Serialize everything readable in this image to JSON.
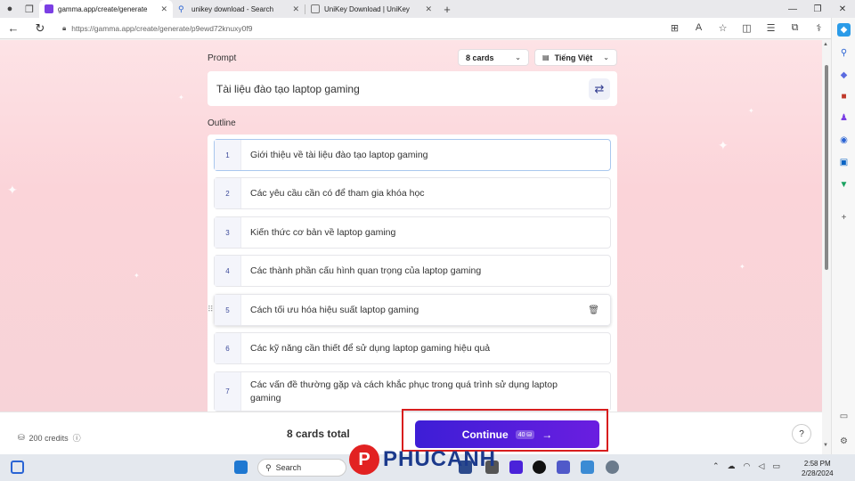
{
  "browser": {
    "tabs": [
      {
        "label": "gamma.app/create/generate",
        "active": true
      },
      {
        "label": "unikey download - Search",
        "active": false
      },
      {
        "label": "UniKey Download | UniKey",
        "active": false
      }
    ],
    "new_tab": "+",
    "url": "https://gamma.app/create/generate/p9ewd72knuxy0f9"
  },
  "prompt": {
    "label": "Prompt",
    "cards_select": "8 cards",
    "language_select": "Tiếng Việt",
    "value": "Tài liệu đào tạo laptop gaming"
  },
  "outline": {
    "label": "Outline",
    "items": [
      {
        "num": "1",
        "text": "Giới thiệu về tài liệu đào tạo laptop gaming"
      },
      {
        "num": "2",
        "text": "Các yêu cầu cần có để tham gia khóa học"
      },
      {
        "num": "3",
        "text": "Kiến thức cơ bản về laptop gaming"
      },
      {
        "num": "4",
        "text": "Các thành phần cấu hình quan trọng của laptop gaming"
      },
      {
        "num": "5",
        "text": "Cách tối ưu hóa hiệu suất laptop gaming"
      },
      {
        "num": "6",
        "text": "Các kỹ năng cần thiết để sử dụng laptop gaming hiệu quả"
      },
      {
        "num": "7",
        "text": "Các vấn đề thường gặp và cách khắc phục trong quá trình sử dụng laptop gaming"
      }
    ]
  },
  "footer": {
    "credits": "200 credits",
    "cards_total": "8 cards total",
    "continue_label": "Continue",
    "continue_cost": "40",
    "help": "?"
  },
  "taskbar": {
    "search_placeholder": "Search",
    "watermark": "PHUCANH",
    "time": "2:58 PM",
    "date": "2/28/2024"
  },
  "colors": {
    "accent": "#4a22d9",
    "highlight_frame": "#d81e1e",
    "page_bg": "#fbd4d9"
  }
}
